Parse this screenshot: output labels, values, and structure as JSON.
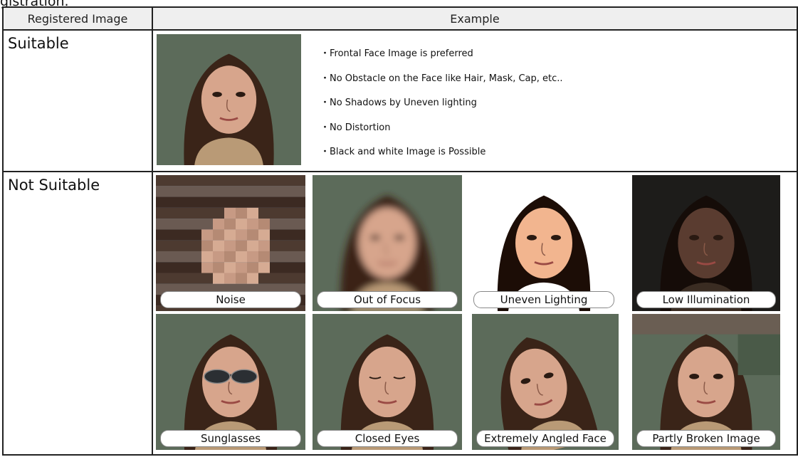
{
  "cut_text": "gistration.",
  "table": {
    "headers": [
      "Registered Image",
      "Example"
    ],
    "suitable": {
      "label": "Suitable",
      "bullets": [
        "・Frontal Face Image is preferred",
        "・No Obstacle on the Face like Hair, Mask, Cap, etc..",
        "・No Shadows by Uneven lighting",
        "・No Distortion",
        "・Black and white Image is Possible"
      ]
    },
    "not_suitable": {
      "label": "Not Suitable",
      "examples": [
        {
          "caption": "Noise",
          "effect": "pixelated"
        },
        {
          "caption": "Out of Focus",
          "effect": "blur"
        },
        {
          "caption": "Uneven Lighting",
          "effect": "overexposed"
        },
        {
          "caption": "Low Illumination",
          "effect": "dark"
        },
        {
          "caption": "Sunglasses",
          "effect": "sunglasses"
        },
        {
          "caption": "Closed Eyes",
          "effect": "closed-eyes"
        },
        {
          "caption": "Extremely Angled Face",
          "effect": "angled"
        },
        {
          "caption": "Partly Broken Image",
          "effect": "broken"
        }
      ]
    }
  },
  "colors": {
    "border": "#222222",
    "header_bg": "#efefef",
    "hair": "#3a2418",
    "skin": "#d7a58c",
    "scarf": "#b99a76",
    "background": "#5c6b5a"
  }
}
